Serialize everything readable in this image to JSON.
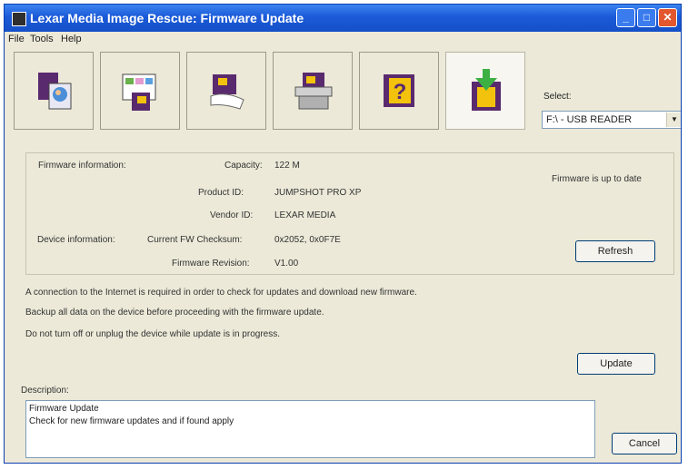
{
  "window": {
    "title": "Lexar Media Image Rescue: Firmware Update"
  },
  "menu": {
    "items": [
      "File",
      "Tools",
      "Help"
    ]
  },
  "toolbar": {
    "icons": [
      "image-rescue-icon",
      "image-browser-icon",
      "card-secure-icon",
      "backup-icon",
      "help-icon",
      "firmware-update-icon"
    ],
    "help_glyph": "?"
  },
  "select": {
    "label": "Select:",
    "value": "F:\\ - USB READER"
  },
  "firmware": {
    "section_label": "Firmware information:",
    "capacity_label": "Capacity:",
    "capacity_value": "122 M",
    "product_label": "Product ID:",
    "product_value": "JUMPSHOT PRO XP",
    "vendor_label": "Vendor ID:",
    "vendor_value": "LEXAR MEDIA",
    "status": "Firmware is up to date"
  },
  "device": {
    "section_label": "Device information:",
    "checksum_label": "Current FW Checksum:",
    "checksum_value": "0x2052, 0x0F7E",
    "revision_label": "Firmware Revision:",
    "revision_value": "V1.00"
  },
  "notes": [
    "A connection to the Internet is required in order to check for updates and download new firmware.",
    "Backup all data on the device before proceeding with the firmware update.",
    "Do not turn off or unplug the device while update is in progress."
  ],
  "buttons": {
    "refresh": "Refresh",
    "update": "Update",
    "cancel": "Cancel"
  },
  "description": {
    "label": "Description:",
    "line1": "Firmware Update",
    "line2": "Check for new firmware updates and if found apply"
  }
}
